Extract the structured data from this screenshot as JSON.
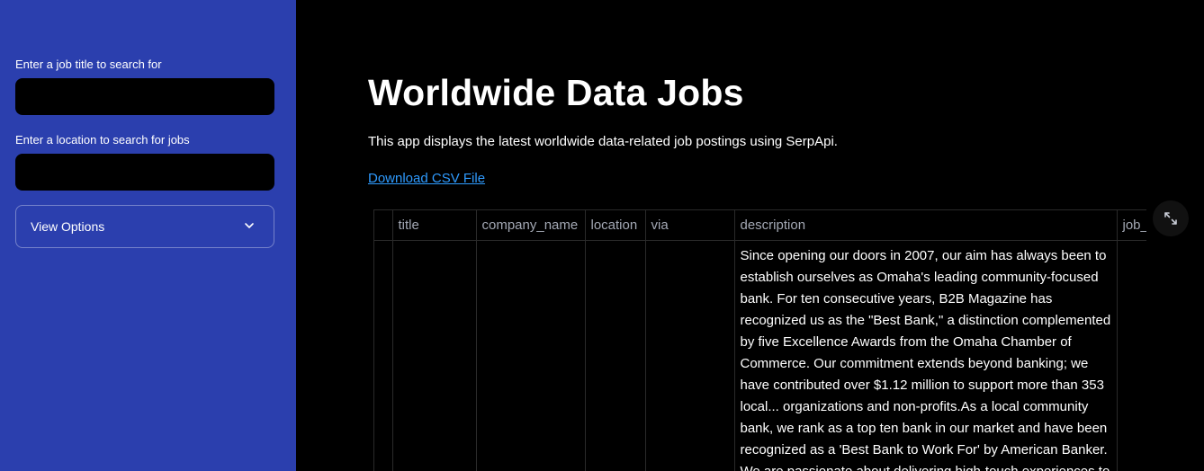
{
  "sidebar": {
    "job_title_label": "Enter a job title to search for",
    "job_title_value": "",
    "location_label": "Enter a location to search for jobs",
    "location_value": "",
    "view_options_label": "View Options"
  },
  "main": {
    "title": "Worldwide Data Jobs",
    "subtitle": "This app displays the latest worldwide data-related job postings using SerpApi.",
    "download_link": "Download CSV File"
  },
  "table": {
    "columns": [
      "",
      "title",
      "company_name",
      "location",
      "via",
      "description",
      "job_"
    ],
    "rows": [
      {
        "index": "",
        "title": "",
        "company_name": "",
        "location": "",
        "via": "",
        "description": "Since opening our doors in 2007, our aim has always been to establish ourselves as Omaha's leading community-focused bank. For ten consecutive years, B2B Magazine has recognized us as the \"Best Bank,\" a distinction complemented by five Excellence Awards from the Omaha Chamber of Commerce. Our commitment extends beyond banking; we have contributed over $1.12 million to support more than 353 local... organizations and non-profits.As a local community bank, we rank as a top ten bank in our market and have been recognized as a 'Best Bank to Work For' by American Banker. We are passionate about delivering high-touch experiences to",
        "job_": ""
      }
    ]
  },
  "icons": {
    "chevron": "chevron-down-icon",
    "expand": "fullscreen-expand-icon"
  },
  "colors": {
    "sidebar_bg": "#2b3fae",
    "main_bg": "#000000",
    "link": "#2f9bff",
    "header_text": "#a3a8b4"
  }
}
